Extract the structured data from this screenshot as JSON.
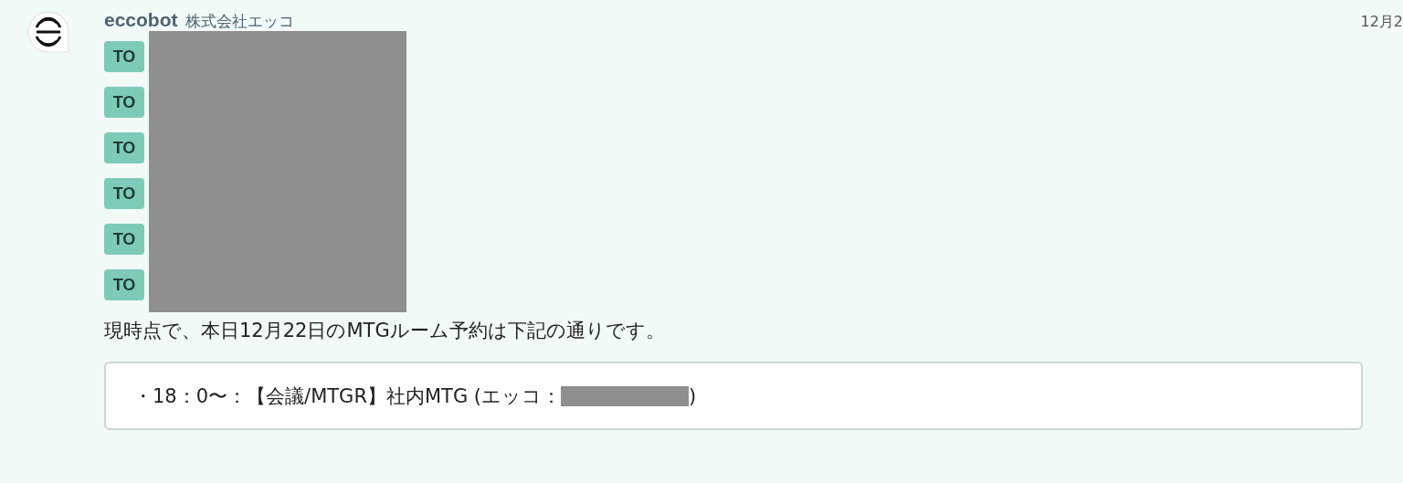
{
  "message": {
    "sender": "eccobot",
    "company": "株式会社エッコ",
    "timestamp": "12月2",
    "mentions": [
      {
        "label": "TO"
      },
      {
        "label": "TO"
      },
      {
        "label": "TO"
      },
      {
        "label": "TO"
      },
      {
        "label": "TO"
      },
      {
        "label": "TO"
      }
    ],
    "body": "現時点で、本日12月22日のMTGルーム予約は下記の通りです。",
    "quote": {
      "text_before": "・18：0〜：【会議/MTGR】社内MTG (エッコ：",
      "text_after": ")"
    }
  }
}
